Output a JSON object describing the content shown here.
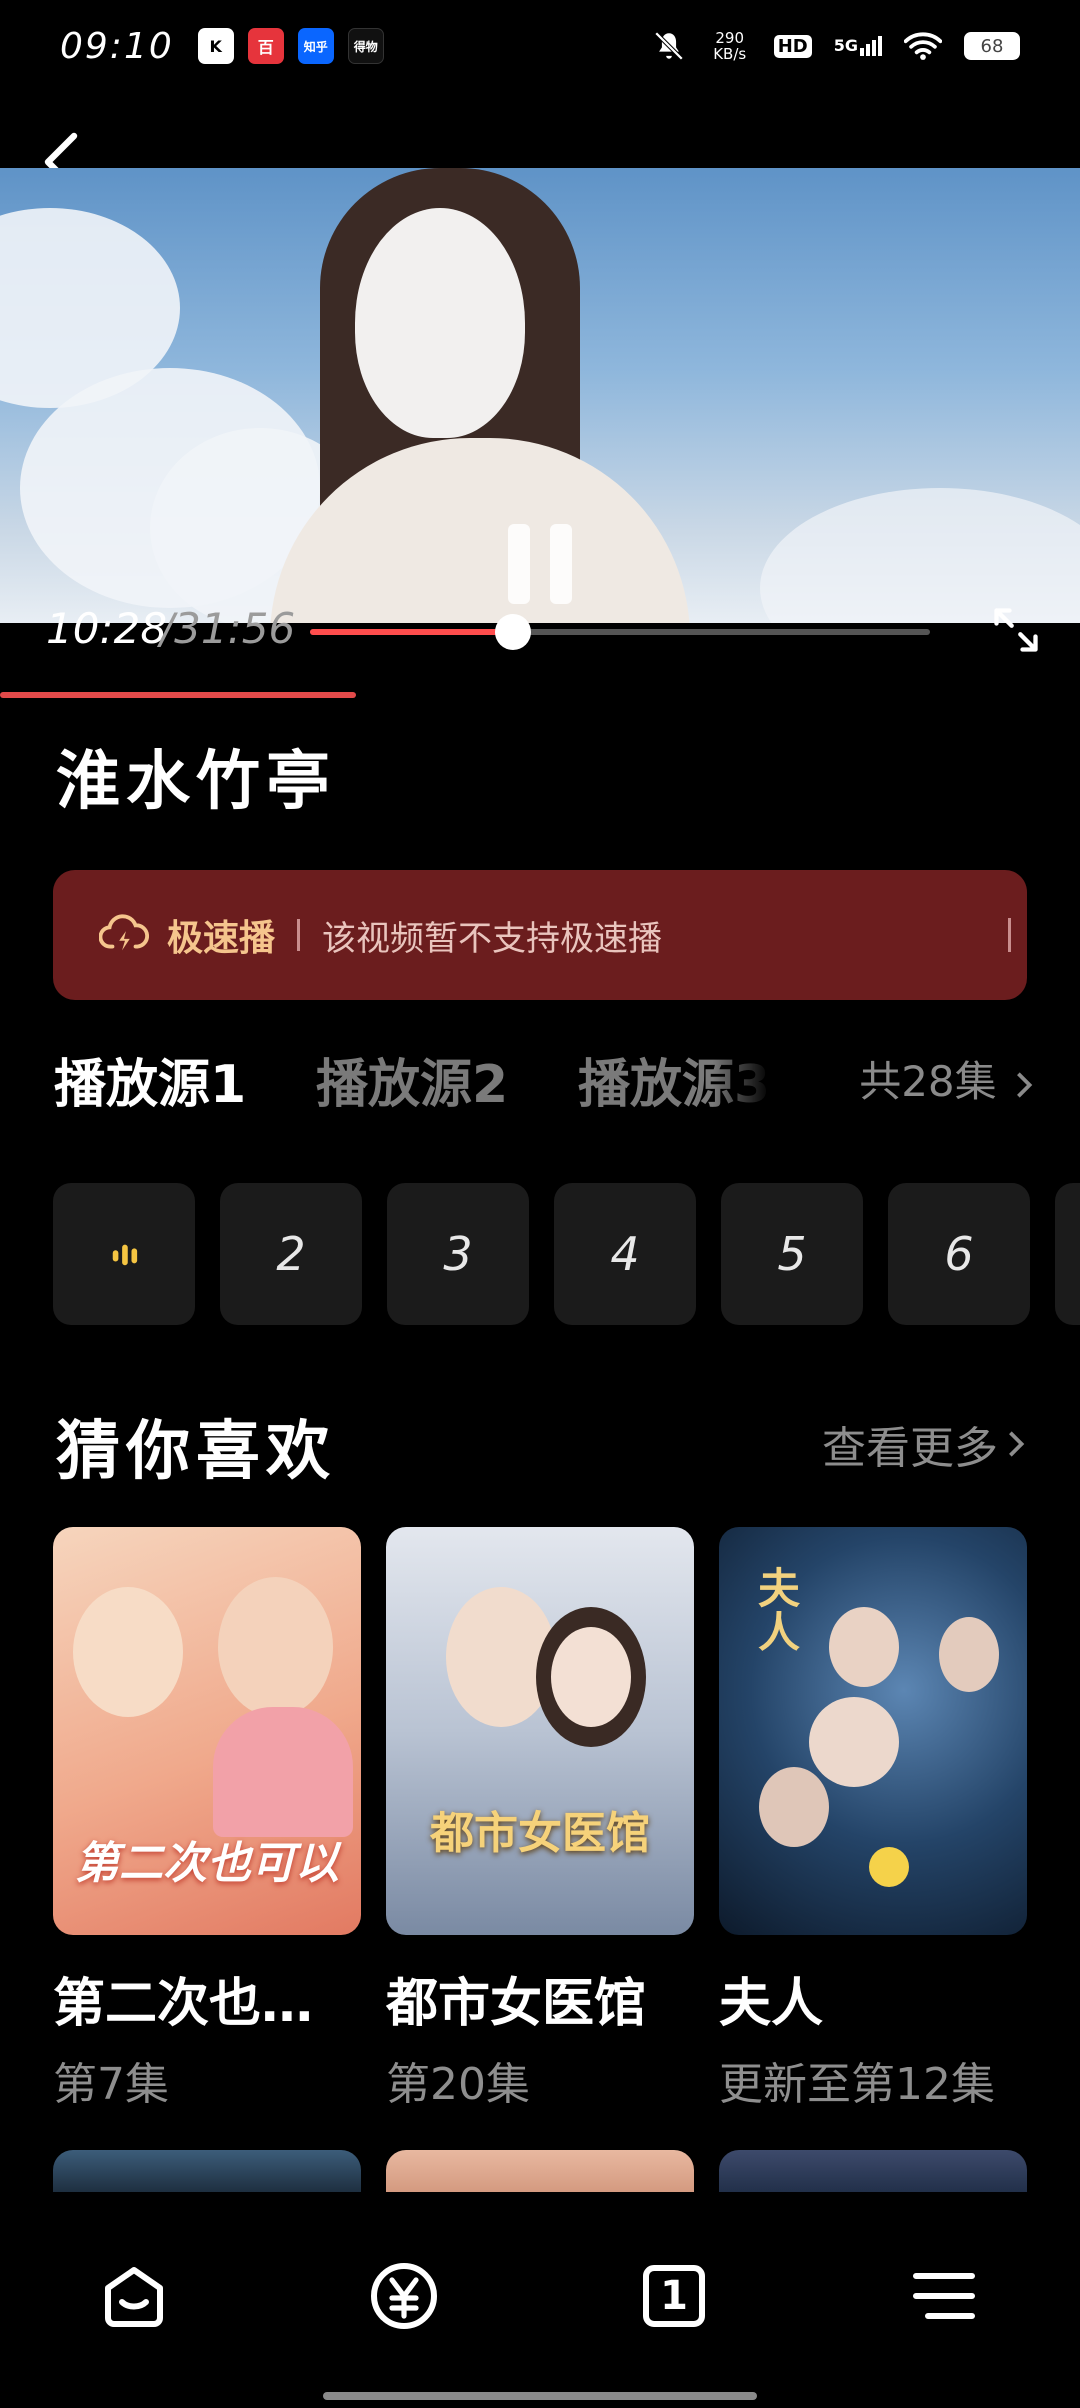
{
  "status_bar": {
    "time": "09:10",
    "apps": [
      {
        "label": "K",
        "color": "#ffffff",
        "text_color": "#000000"
      },
      {
        "label": "百",
        "color": "#e6343c",
        "text_color": "#ffffff"
      },
      {
        "label": "知乎",
        "color": "#0a66ff",
        "text_color": "#ffffff"
      },
      {
        "label": "得物",
        "color": "#111111",
        "text_color": "#ffffff"
      }
    ],
    "network_speed": "290 KB/s",
    "hd": "HD",
    "signal": "5G",
    "battery": "68"
  },
  "player": {
    "current_time": "10:28",
    "total_time": "/31:56",
    "progress": 0.328,
    "buffer_progress": 0.33,
    "accent_color": "#ff4d4d"
  },
  "title": "淮水竹亭",
  "speed_banner": {
    "label": "极速播",
    "message": "该视频暂不支持极速播"
  },
  "sources": {
    "tabs": [
      "播放源1",
      "播放源2",
      "播放源3"
    ],
    "active": 0,
    "episodes_total": "共28集"
  },
  "episodes": [
    "",
    "2",
    "3",
    "4",
    "5",
    "6"
  ],
  "recommend": {
    "title": "猜你喜欢",
    "see_more": "查看更多",
    "items": [
      {
        "title": "第二次也…",
        "sub": "第7集",
        "poster_text": "第二次也可以",
        "colors": [
          "#f4c6a6",
          "#e8846b"
        ]
      },
      {
        "title": "都市女医馆",
        "sub": "第20集",
        "poster_text": "都市女医馆",
        "colors": [
          "#d9dde6",
          "#7d8ba3"
        ]
      },
      {
        "title": "夫人",
        "sub": "更新至第12集",
        "poster_text": "夫人",
        "colors": [
          "#27466b",
          "#0e1b2c"
        ]
      }
    ]
  },
  "bottom_nav": [
    "home-icon",
    "yuan-icon",
    "tab-count-icon",
    "menu-icon"
  ],
  "tab_count": "1"
}
